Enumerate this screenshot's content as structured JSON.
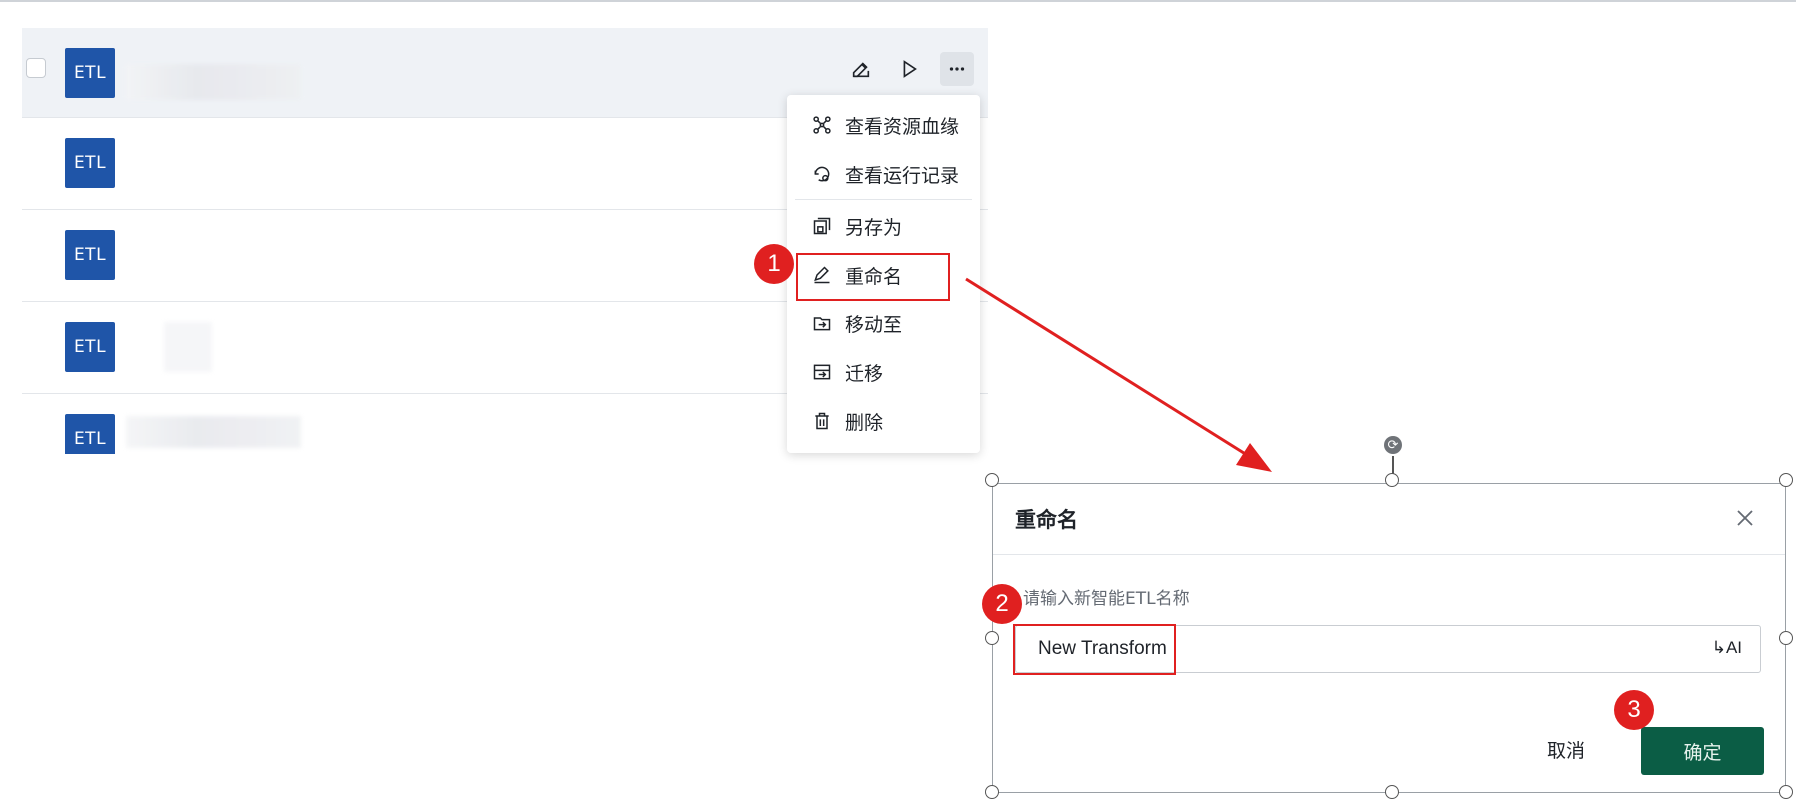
{
  "list": {
    "rows": [
      {
        "badge": "ETL"
      },
      {
        "badge": "ETL"
      },
      {
        "badge": "ETL"
      },
      {
        "badge": "ETL"
      },
      {
        "badge": "ETL"
      }
    ]
  },
  "menu": {
    "items": [
      {
        "label": "查看资源血缘",
        "icon": "lineage-icon"
      },
      {
        "label": "查看运行记录",
        "icon": "history-icon"
      },
      {
        "label": "另存为",
        "icon": "save-as-icon"
      },
      {
        "label": "重命名",
        "icon": "rename-pencil-icon"
      },
      {
        "label": "移动至",
        "icon": "move-to-folder-icon"
      },
      {
        "label": "迁移",
        "icon": "migrate-icon"
      },
      {
        "label": "删除",
        "icon": "trash-icon"
      }
    ]
  },
  "dialog": {
    "title": "重命名",
    "field_label": "请输入新智能ETL名称",
    "input_value": "New Transform",
    "ai_label": "AI",
    "cancel_label": "取消",
    "ok_label": "确定"
  },
  "annotations": {
    "step1": "1",
    "step2": "2",
    "step3": "3",
    "highlight_color": "#e02020"
  },
  "colors": {
    "etl_badge": "#1f55a8",
    "primary_button": "#0b5d45"
  }
}
